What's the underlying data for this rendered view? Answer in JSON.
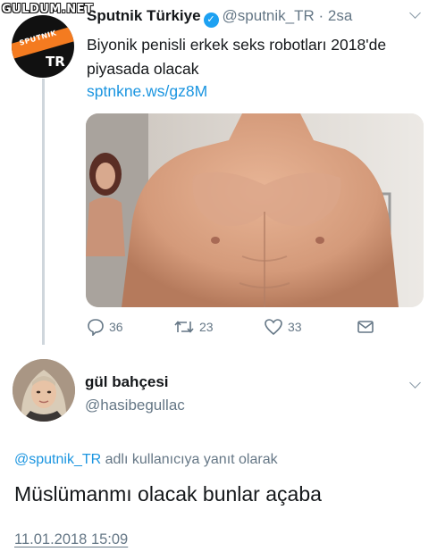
{
  "watermark": "GULDUM.NET",
  "tweet": {
    "avatar_band": "SPUTNIK",
    "avatar_letters": "TR",
    "author": "Sputnik Türkiye",
    "handle": "@sputnik_TR",
    "separator": "·",
    "time": "2sa",
    "text": "Biyonik penisli erkek seks robotları 2018'de piyasada olacak",
    "link": "sptnkne.ws/gz8M",
    "actions": {
      "replies": "36",
      "retweets": "23",
      "likes": "33"
    },
    "icons": {
      "verified": "verified-badge-icon",
      "more": "chevron-down-icon",
      "reply": "reply-bubble-icon",
      "retweet": "retweet-arrows-icon",
      "like": "heart-icon",
      "dm": "envelope-icon"
    }
  },
  "reply": {
    "author": "gül bahçesi",
    "handle": "@hasibegullac",
    "replying_mention": "@sputnik_TR",
    "replying_rest": " adlı kullanıcıya yanıt olarak",
    "text": "Müslümanmı olacak bunlar açaba",
    "date": "11.01.2018 15:09"
  },
  "colors": {
    "accent": "#1b95e0",
    "muted": "#657786",
    "verified": "#1da1f2",
    "brand_orange": "#f47b20"
  }
}
